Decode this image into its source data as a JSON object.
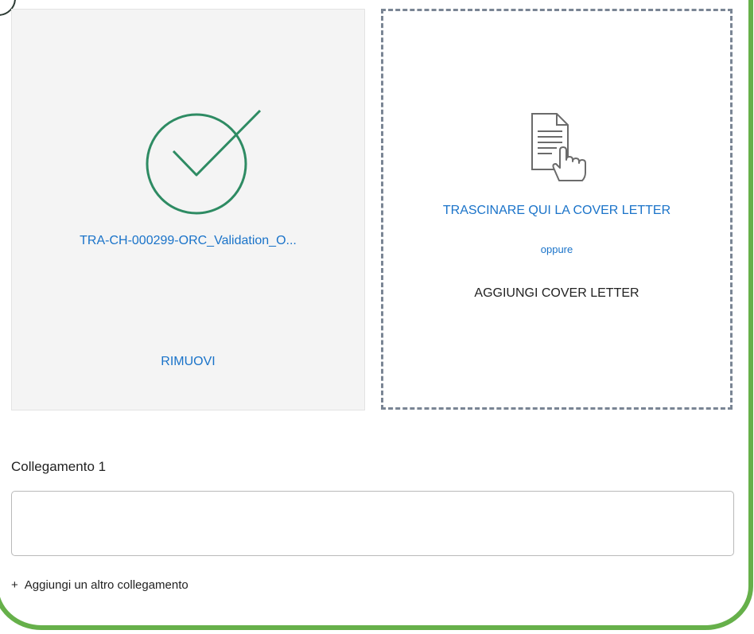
{
  "cv_upload": {
    "file_name": "TRA-CH-000299-ORC_Validation_O...",
    "remove_label": "RIMUOVI",
    "status_icon": "check-circle-icon"
  },
  "cover_letter": {
    "drop_label": "TRASCINARE QUI LA COVER LETTER",
    "or_label": "oppure",
    "add_label": "AGGIUNGI COVER LETTER",
    "icon": "document-drag-icon"
  },
  "links": {
    "field_label": "Collegamento 1",
    "field_value": "",
    "add_label": "Aggiungi un altro collegamento",
    "add_symbol": "+"
  },
  "colors": {
    "accent_blue": "#1a73c9",
    "success_green": "#2e8b63",
    "frame_green": "#66b04a",
    "dashed_border": "#7a8594"
  }
}
